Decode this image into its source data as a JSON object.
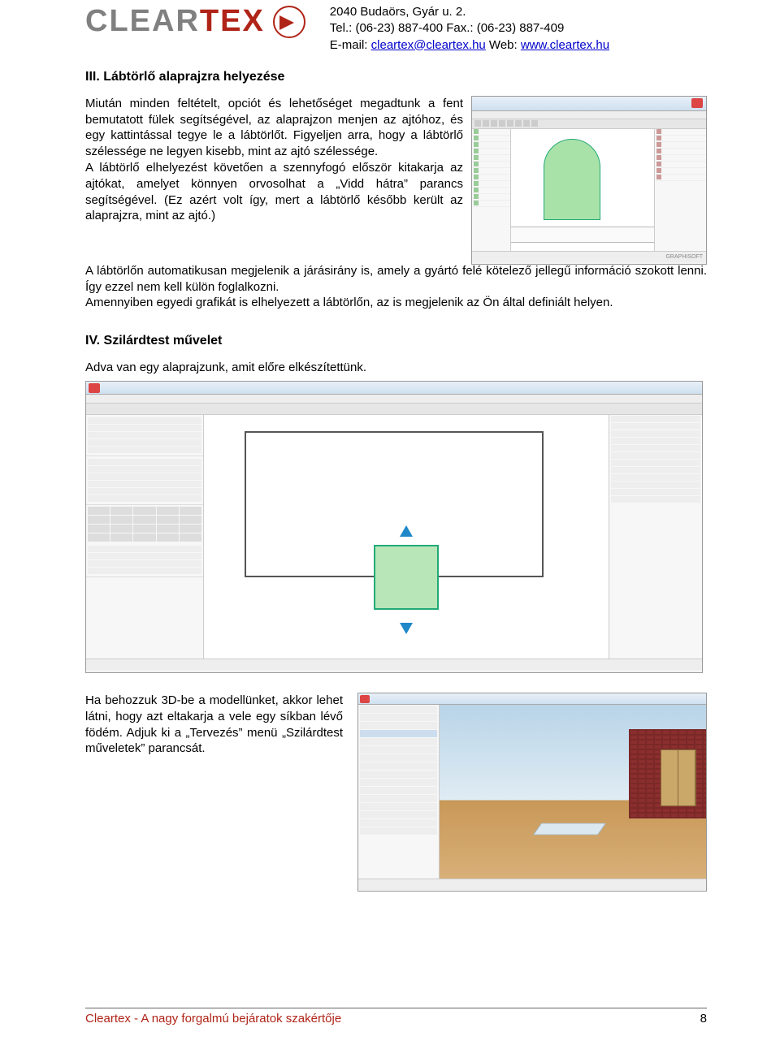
{
  "header": {
    "logo_part1": "CLEAR",
    "logo_part2": "TEX",
    "address": "2040 Budaörs, Gyár u. 2.",
    "tel_label": "Tel.: (06-23) 887-400  Fax.: (06-23) 887-409",
    "email_label": "E-mail: ",
    "email_link": "cleartex@cleartex.hu",
    "web_label": " Web: ",
    "web_link": "www.cleartex.hu"
  },
  "section3": {
    "title": "III. Lábtörlő alaprajzra helyezése",
    "para": "Miután minden feltételt, opciót és lehetőséget megadtunk a fent bemutatott fülek segítségével, az alaprajzon menjen az ajtóhoz, és egy kattintással tegye le a lábtörlőt. Figyeljen arra, hogy a lábtörlő szélessége ne legyen kisebb, mint az ajtó szélessége.\nA lábtörlő elhelyezést követően a szennyfogó először kitakarja az ajtókat, amelyet könnyen orvosolhat a „Vidd hátra” parancs segítségével. (Ez azért volt így, mert a lábtörlő később került az alaprajzra, mint az ajtó.)",
    "para_wide": "A lábtörlőn automatikusan megjelenik a járásirány is, amely a gyártó felé kötelező jellegű információ szokott lenni. Így ezzel nem kell külön foglalkozni.\nAmennyiben egyedi grafikát is elhelyezett a lábtörlőn, az is megjelenik az Ön által definiált helyen."
  },
  "section4": {
    "title": "IV. Szilárdtest művelet",
    "intro": "Adva van egy alaprajzunk, amit előre elkészítettünk.",
    "para3d": "Ha behozzuk 3D-be a modellünket, akkor lehet látni, hogy azt eltakarja a vele egy síkban lévő födém. Adjuk ki a „Tervezés” menü „Szilárdtest műveletek” parancsát."
  },
  "screenshots": {
    "graphisoft_label": "GRAPHISOFT"
  },
  "footer": {
    "tagline": "Cleartex - A nagy forgalmú bejáratok szakértője",
    "page": "8"
  }
}
